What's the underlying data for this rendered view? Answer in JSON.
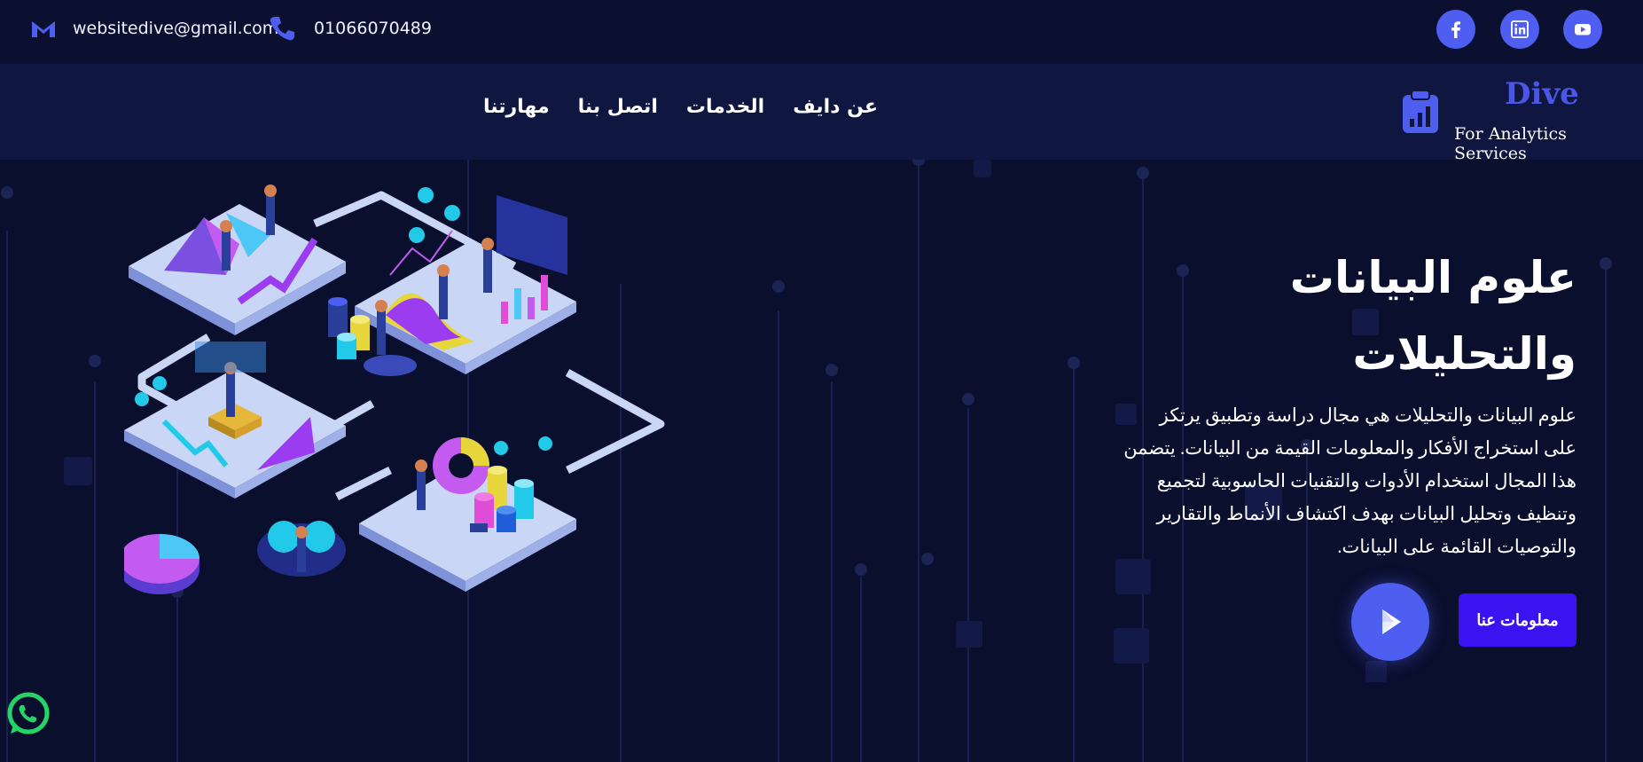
{
  "topbar": {
    "email": "websitedive@gmail.com",
    "phone": "01066070489",
    "socials": [
      {
        "name": "facebook",
        "icon": "facebook-icon"
      },
      {
        "name": "linkedin",
        "icon": "linkedin-icon"
      },
      {
        "name": "youtube",
        "icon": "youtube-icon"
      }
    ]
  },
  "nav": {
    "links": [
      "عن دايف",
      "الخدمات",
      "اتصل بنا",
      "مهارتنا"
    ]
  },
  "logo": {
    "title": "Dive",
    "subtitle": "For Analytics Services",
    "icon": "clipboard-chart-icon"
  },
  "hero": {
    "title_line1": "علوم البيانات",
    "title_line2": "والتحليلات",
    "description_lines": [
      "علوم البيانات والتحليلات هي مجال دراسة وتطبيق يرتكز",
      "على استخراج الأفكار والمعلومات القيمة من البيانات. يتضمن",
      "هذا المجال استخدام الأدوات والتقنيات الحاسوبية لتجميع",
      "وتنظيف وتحليل البيانات بهدف اكتشاف الأنماط والتقارير",
      "والتوصيات القائمة على البيانات."
    ],
    "about_button": "معلومات عنا",
    "play_icon": "play-icon"
  },
  "colors": {
    "background": "#0b0f2e",
    "accent": "#4d5ef0",
    "button": "#3a14f0",
    "whatsapp": "#25d366"
  }
}
